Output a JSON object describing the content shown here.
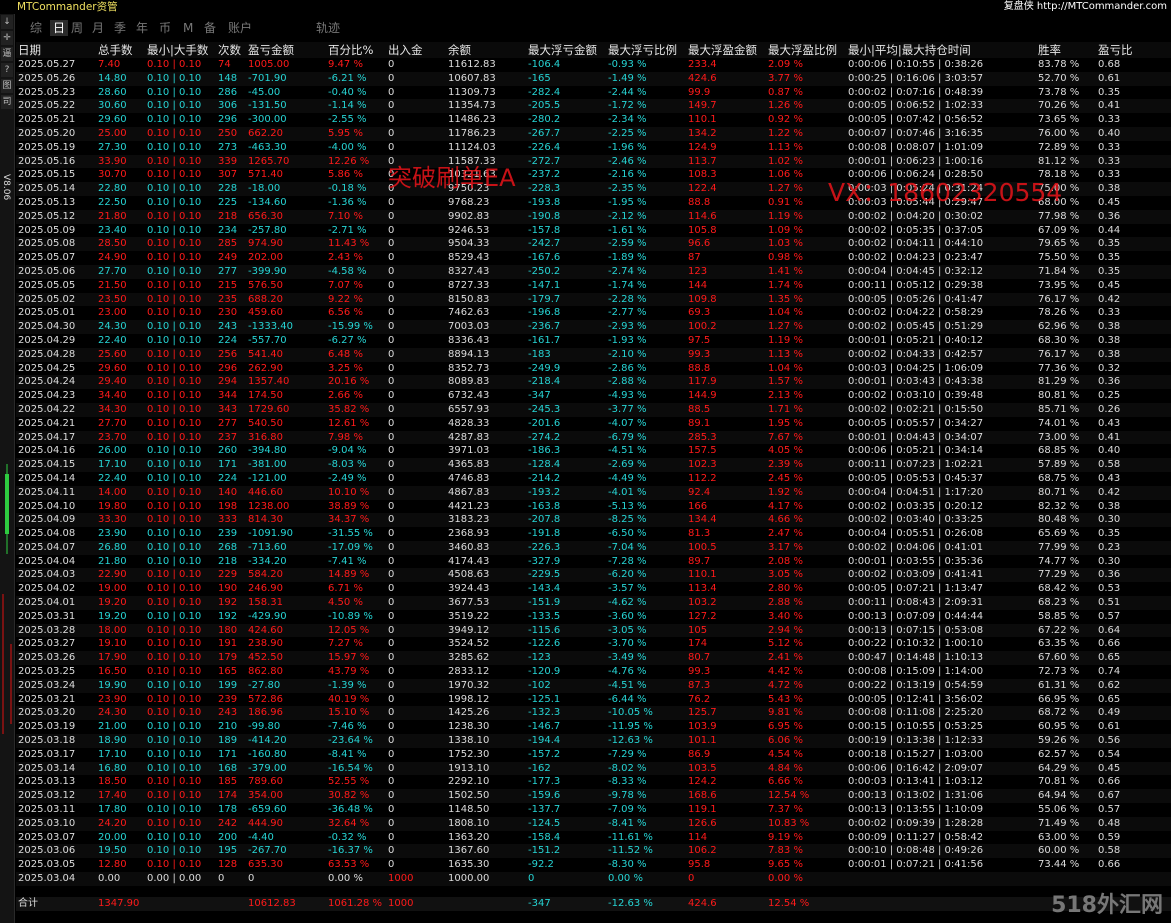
{
  "app": {
    "title": "MTCommander资管",
    "link": "复盘侠 http://MTCommander.com"
  },
  "toolbar": {
    "buttons": [
      "↓",
      "✛",
      "逼",
      "?",
      "图",
      "司"
    ],
    "version": "V8.06"
  },
  "tabs": [
    {
      "label": "综",
      "active": false
    },
    {
      "label": "日",
      "active": true
    },
    {
      "label": "周",
      "active": false
    },
    {
      "label": "月",
      "active": false
    },
    {
      "label": "季",
      "active": false
    },
    {
      "label": "年",
      "active": false
    },
    {
      "label": "币",
      "active": false
    },
    {
      "label": "M",
      "active": false
    },
    {
      "label": "备",
      "active": false
    },
    {
      "label": "账户",
      "active": false
    },
    {
      "label": "轨迹",
      "active": false
    }
  ],
  "columns": [
    "日期",
    "总手数",
    "最小|大手数",
    "次数",
    "盈亏金额",
    "百分比%",
    "出入金",
    "余额",
    "最大浮亏金额",
    "最大浮亏比例",
    "最大浮盈金额",
    "最大浮盈比例",
    "最小|平均|最大持仓时间",
    "胜率",
    "盈亏比"
  ],
  "rows": [
    [
      "2025.05.27",
      "7.40",
      "0.10 | 0.10",
      "74",
      "1005.00",
      "9.47 %",
      "0",
      "11612.83",
      "-106.4",
      "-0.93 %",
      "233.4",
      "2.09 %",
      "0:00:06 | 0:10:55 | 0:38:26",
      "83.78 %",
      "0.68"
    ],
    [
      "2025.05.26",
      "14.80",
      "0.10 | 0.10",
      "148",
      "-701.90",
      "-6.21 %",
      "0",
      "10607.83",
      "-165",
      "-1.49 %",
      "424.6",
      "3.77 %",
      "0:00:25 | 0:16:06 | 3:03:57",
      "52.70 %",
      "0.61"
    ],
    [
      "2025.05.23",
      "28.60",
      "0.10 | 0.10",
      "286",
      "-45.00",
      "-0.40 %",
      "0",
      "11309.73",
      "-282.4",
      "-2.44 %",
      "99.9",
      "0.87 %",
      "0:00:02 | 0:07:16 | 0:48:39",
      "73.78 %",
      "0.35"
    ],
    [
      "2025.05.22",
      "30.60",
      "0.10 | 0.10",
      "306",
      "-131.50",
      "-1.14 %",
      "0",
      "11354.73",
      "-205.5",
      "-1.72 %",
      "149.7",
      "1.26 %",
      "0:00:05 | 0:06:52 | 1:02:33",
      "70.26 %",
      "0.41"
    ],
    [
      "2025.05.21",
      "29.60",
      "0.10 | 0.10",
      "296",
      "-300.00",
      "-2.55 %",
      "0",
      "11486.23",
      "-280.2",
      "-2.34 %",
      "110.1",
      "0.92 %",
      "0:00:05 | 0:07:42 | 0:56:52",
      "73.65 %",
      "0.33"
    ],
    [
      "2025.05.20",
      "25.00",
      "0.10 | 0.10",
      "250",
      "662.20",
      "5.95 %",
      "0",
      "11786.23",
      "-267.7",
      "-2.25 %",
      "134.2",
      "1.22 %",
      "0:00:07 | 0:07:46 | 3:16:35",
      "76.00 %",
      "0.40"
    ],
    [
      "2025.05.19",
      "27.30",
      "0.10 | 0.10",
      "273",
      "-463.30",
      "-4.00 %",
      "0",
      "11124.03",
      "-226.4",
      "-1.96 %",
      "124.9",
      "1.13 %",
      "0:00:08 | 0:08:07 | 1:01:09",
      "72.89 %",
      "0.33"
    ],
    [
      "2025.05.16",
      "33.90",
      "0.10 | 0.10",
      "339",
      "1265.70",
      "12.26 %",
      "0",
      "11587.33",
      "-272.7",
      "-2.46 %",
      "113.7",
      "1.02 %",
      "0:00:01 | 0:06:23 | 1:00:16",
      "81.12 %",
      "0.33"
    ],
    [
      "2025.05.15",
      "30.70",
      "0.10 | 0.10",
      "307",
      "571.40",
      "5.86 %",
      "0",
      "10321.63",
      "-237.2",
      "-2.16 %",
      "108.3",
      "1.06 %",
      "0:00:06 | 0:06:24 | 0:28:50",
      "78.18 %",
      "0.33"
    ],
    [
      "2025.05.14",
      "22.80",
      "0.10 | 0.10",
      "228",
      "-18.00",
      "-0.18 %",
      "0",
      "9750.23",
      "-228.3",
      "-2.35 %",
      "122.4",
      "1.27 %",
      "0:00:03 | 0:05:24 | 0:31:24",
      "75.00 %",
      "0.38"
    ],
    [
      "2025.05.13",
      "22.50",
      "0.10 | 0.10",
      "225",
      "-134.60",
      "-1.36 %",
      "0",
      "9768.23",
      "-193.8",
      "-1.95 %",
      "88.8",
      "0.91 %",
      "0:00:03 | 0:05:44 | 0:29:47",
      "68.00 %",
      "0.45"
    ],
    [
      "2025.05.12",
      "21.80",
      "0.10 | 0.10",
      "218",
      "656.30",
      "7.10 %",
      "0",
      "9902.83",
      "-190.8",
      "-2.12 %",
      "114.6",
      "1.19 %",
      "0:00:02 | 0:04:20 | 0:30:02",
      "77.98 %",
      "0.36"
    ],
    [
      "2025.05.09",
      "23.40",
      "0.10 | 0.10",
      "234",
      "-257.80",
      "-2.71 %",
      "0",
      "9246.53",
      "-157.8",
      "-1.61 %",
      "105.8",
      "1.09 %",
      "0:00:02 | 0:05:35 | 0:37:05",
      "67.09 %",
      "0.44"
    ],
    [
      "2025.05.08",
      "28.50",
      "0.10 | 0.10",
      "285",
      "974.90",
      "11.43 %",
      "0",
      "9504.33",
      "-242.7",
      "-2.59 %",
      "96.6",
      "1.03 %",
      "0:00:02 | 0:04:11 | 0:44:10",
      "79.65 %",
      "0.35"
    ],
    [
      "2025.05.07",
      "24.90",
      "0.10 | 0.10",
      "249",
      "202.00",
      "2.43 %",
      "0",
      "8529.43",
      "-167.6",
      "-1.89 %",
      "87",
      "0.98 %",
      "0:00:02 | 0:04:23 | 0:23:47",
      "75.50 %",
      "0.35"
    ],
    [
      "2025.05.06",
      "27.70",
      "0.10 | 0.10",
      "277",
      "-399.90",
      "-4.58 %",
      "0",
      "8327.43",
      "-250.2",
      "-2.74 %",
      "123",
      "1.41 %",
      "0:00:04 | 0:04:45 | 0:32:12",
      "71.84 %",
      "0.35"
    ],
    [
      "2025.05.05",
      "21.50",
      "0.10 | 0.10",
      "215",
      "576.50",
      "7.07 %",
      "0",
      "8727.33",
      "-147.1",
      "-1.74 %",
      "144",
      "1.74 %",
      "0:00:11 | 0:05:12 | 0:29:38",
      "73.95 %",
      "0.45"
    ],
    [
      "2025.05.02",
      "23.50",
      "0.10 | 0.10",
      "235",
      "688.20",
      "9.22 %",
      "0",
      "8150.83",
      "-179.7",
      "-2.28 %",
      "109.8",
      "1.35 %",
      "0:00:05 | 0:05:26 | 0:41:47",
      "76.17 %",
      "0.42"
    ],
    [
      "2025.05.01",
      "23.00",
      "0.10 | 0.10",
      "230",
      "459.60",
      "6.56 %",
      "0",
      "7462.63",
      "-196.8",
      "-2.77 %",
      "69.3",
      "1.04 %",
      "0:00:02 | 0:04:22 | 0:58:29",
      "78.26 %",
      "0.33"
    ],
    [
      "2025.04.30",
      "24.30",
      "0.10 | 0.10",
      "243",
      "-1333.40",
      "-15.99 %",
      "0",
      "7003.03",
      "-236.7",
      "-2.93 %",
      "100.2",
      "1.27 %",
      "0:00:02 | 0:05:45 | 0:51:29",
      "62.96 %",
      "0.38"
    ],
    [
      "2025.04.29",
      "22.40",
      "0.10 | 0.10",
      "224",
      "-557.70",
      "-6.27 %",
      "0",
      "8336.43",
      "-161.7",
      "-1.93 %",
      "97.5",
      "1.19 %",
      "0:00:01 | 0:05:21 | 0:40:12",
      "68.30 %",
      "0.38"
    ],
    [
      "2025.04.28",
      "25.60",
      "0.10 | 0.10",
      "256",
      "541.40",
      "6.48 %",
      "0",
      "8894.13",
      "-183",
      "-2.10 %",
      "99.3",
      "1.13 %",
      "0:00:02 | 0:04:33 | 0:42:57",
      "76.17 %",
      "0.38"
    ],
    [
      "2025.04.25",
      "29.60",
      "0.10 | 0.10",
      "296",
      "262.90",
      "3.25 %",
      "0",
      "8352.73",
      "-249.9",
      "-2.86 %",
      "88.8",
      "1.04 %",
      "0:00:03 | 0:04:25 | 1:06:09",
      "77.36 %",
      "0.32"
    ],
    [
      "2025.04.24",
      "29.40",
      "0.10 | 0.10",
      "294",
      "1357.40",
      "20.16 %",
      "0",
      "8089.83",
      "-218.4",
      "-2.88 %",
      "117.9",
      "1.57 %",
      "0:00:01 | 0:03:43 | 0:43:38",
      "81.29 %",
      "0.36"
    ],
    [
      "2025.04.23",
      "34.40",
      "0.10 | 0.10",
      "344",
      "174.50",
      "2.66 %",
      "0",
      "6732.43",
      "-347",
      "-4.93 %",
      "144.9",
      "2.13 %",
      "0:00:02 | 0:03:10 | 0:39:48",
      "80.81 %",
      "0.25"
    ],
    [
      "2025.04.22",
      "34.30",
      "0.10 | 0.10",
      "343",
      "1729.60",
      "35.82 %",
      "0",
      "6557.93",
      "-245.3",
      "-3.77 %",
      "88.5",
      "1.71 %",
      "0:00:02 | 0:02:21 | 0:15:50",
      "85.71 %",
      "0.26"
    ],
    [
      "2025.04.21",
      "27.70",
      "0.10 | 0.10",
      "277",
      "540.50",
      "12.61 %",
      "0",
      "4828.33",
      "-201.6",
      "-4.07 %",
      "89.1",
      "1.95 %",
      "0:00:05 | 0:05:57 | 0:34:27",
      "74.01 %",
      "0.43"
    ],
    [
      "2025.04.17",
      "23.70",
      "0.10 | 0.10",
      "237",
      "316.80",
      "7.98 %",
      "0",
      "4287.83",
      "-274.2",
      "-6.79 %",
      "285.3",
      "7.67 %",
      "0:00:01 | 0:04:43 | 0:34:07",
      "73.00 %",
      "0.41"
    ],
    [
      "2025.04.16",
      "26.00",
      "0.10 | 0.10",
      "260",
      "-394.80",
      "-9.04 %",
      "0",
      "3971.03",
      "-186.3",
      "-4.51 %",
      "157.5",
      "4.05 %",
      "0:00:06 | 0:05:21 | 0:34:14",
      "68.85 %",
      "0.40"
    ],
    [
      "2025.04.15",
      "17.10",
      "0.10 | 0.10",
      "171",
      "-381.00",
      "-8.03 %",
      "0",
      "4365.83",
      "-128.4",
      "-2.69 %",
      "102.3",
      "2.39 %",
      "0:00:11 | 0:07:23 | 1:02:21",
      "57.89 %",
      "0.58"
    ],
    [
      "2025.04.14",
      "22.40",
      "0.10 | 0.10",
      "224",
      "-121.00",
      "-2.49 %",
      "0",
      "4746.83",
      "-214.2",
      "-4.49 %",
      "112.2",
      "2.45 %",
      "0:00:05 | 0:05:53 | 0:45:37",
      "68.75 %",
      "0.43"
    ],
    [
      "2025.04.11",
      "14.00",
      "0.10 | 0.10",
      "140",
      "446.60",
      "10.10 %",
      "0",
      "4867.83",
      "-193.2",
      "-4.01 %",
      "92.4",
      "1.92 %",
      "0:00:04 | 0:04:51 | 1:17:20",
      "80.71 %",
      "0.42"
    ],
    [
      "2025.04.10",
      "19.80",
      "0.10 | 0.10",
      "198",
      "1238.00",
      "38.89 %",
      "0",
      "4421.23",
      "-163.8",
      "-5.13 %",
      "166",
      "4.17 %",
      "0:00:02 | 0:03:35 | 0:20:12",
      "82.32 %",
      "0.38"
    ],
    [
      "2025.04.09",
      "33.30",
      "0.10 | 0.10",
      "333",
      "814.30",
      "34.37 %",
      "0",
      "3183.23",
      "-207.8",
      "-8.25 %",
      "134.4",
      "4.66 %",
      "0:00:02 | 0:03:40 | 0:33:25",
      "80.48 %",
      "0.30"
    ],
    [
      "2025.04.08",
      "23.90",
      "0.10 | 0.10",
      "239",
      "-1091.90",
      "-31.55 %",
      "0",
      "2368.93",
      "-191.8",
      "-6.50 %",
      "81.3",
      "2.47 %",
      "0:00:04 | 0:05:51 | 0:26:08",
      "65.69 %",
      "0.35"
    ],
    [
      "2025.04.07",
      "26.80",
      "0.10 | 0.10",
      "268",
      "-713.60",
      "-17.09 %",
      "0",
      "3460.83",
      "-226.3",
      "-7.04 %",
      "100.5",
      "3.17 %",
      "0:00:02 | 0:04:06 | 0:41:01",
      "77.99 %",
      "0.23"
    ],
    [
      "2025.04.04",
      "21.80",
      "0.10 | 0.10",
      "218",
      "-334.20",
      "-7.41 %",
      "0",
      "4174.43",
      "-327.9",
      "-7.28 %",
      "89.7",
      "2.08 %",
      "0:00:01 | 0:03:55 | 0:35:36",
      "74.77 %",
      "0.30"
    ],
    [
      "2025.04.03",
      "22.90",
      "0.10 | 0.10",
      "229",
      "584.20",
      "14.89 %",
      "0",
      "4508.63",
      "-229.5",
      "-6.20 %",
      "110.1",
      "3.05 %",
      "0:00:02 | 0:03:09 | 0:41:41",
      "77.29 %",
      "0.36"
    ],
    [
      "2025.04.02",
      "19.00",
      "0.10 | 0.10",
      "190",
      "246.90",
      "6.71 %",
      "0",
      "3924.43",
      "-143.4",
      "-3.57 %",
      "113.4",
      "2.80 %",
      "0:00:05 | 0:07:21 | 1:13:47",
      "68.42 %",
      "0.53"
    ],
    [
      "2025.04.01",
      "19.20",
      "0.10 | 0.10",
      "192",
      "158.31",
      "4.50 %",
      "0",
      "3677.53",
      "-151.9",
      "-4.62 %",
      "103.2",
      "2.88 %",
      "0:00:11 | 0:08:43 | 2:09:31",
      "68.23 %",
      "0.51"
    ],
    [
      "2025.03.31",
      "19.20",
      "0.10 | 0.10",
      "192",
      "-429.90",
      "-10.89 %",
      "0",
      "3519.22",
      "-133.5",
      "-3.60 %",
      "127.2",
      "3.40 %",
      "0:00:13 | 0:07:09 | 0:44:44",
      "58.85 %",
      "0.57"
    ],
    [
      "2025.03.28",
      "18.00",
      "0.10 | 0.10",
      "180",
      "424.60",
      "12.05 %",
      "0",
      "3949.12",
      "-115.6",
      "-3.05 %",
      "105",
      "2.94 %",
      "0:00:13 | 0:07:15 | 0:53:08",
      "67.22 %",
      "0.64"
    ],
    [
      "2025.03.27",
      "19.10",
      "0.10 | 0.10",
      "191",
      "238.90",
      "7.27 %",
      "0",
      "3524.52",
      "-122.6",
      "-3.70 %",
      "174",
      "5.12 %",
      "0:00:22 | 0:10:32 | 1:00:10",
      "63.35 %",
      "0.66"
    ],
    [
      "2025.03.26",
      "17.90",
      "0.10 | 0.10",
      "179",
      "452.50",
      "15.97 %",
      "0",
      "3285.62",
      "-123",
      "-3.49 %",
      "80.7",
      "2.41 %",
      "0:00:47 | 0:14:48 | 1:10:13",
      "67.60 %",
      "0.65"
    ],
    [
      "2025.03.25",
      "16.50",
      "0.10 | 0.10",
      "165",
      "862.80",
      "43.79 %",
      "0",
      "2833.12",
      "-120.9",
      "-4.76 %",
      "99.3",
      "4.42 %",
      "0:00:08 | 0:15:09 | 1:14:00",
      "72.73 %",
      "0.74"
    ],
    [
      "2025.03.24",
      "19.90",
      "0.10 | 0.10",
      "199",
      "-27.80",
      "-1.39 %",
      "0",
      "1970.32",
      "-102",
      "-4.51 %",
      "87.3",
      "4.72 %",
      "0:00:22 | 0:13:19 | 0:54:59",
      "61.31 %",
      "0.62"
    ],
    [
      "2025.03.21",
      "23.90",
      "0.10 | 0.10",
      "239",
      "572.86",
      "40.19 %",
      "0",
      "1998.12",
      "-125.1",
      "-6.44 %",
      "76.2",
      "5.43 %",
      "0:00:05 | 0:12:41 | 3:56:02",
      "66.95 %",
      "0.65"
    ],
    [
      "2025.03.20",
      "24.30",
      "0.10 | 0.10",
      "243",
      "186.96",
      "15.10 %",
      "0",
      "1425.26",
      "-132.3",
      "-10.05 %",
      "125.7",
      "9.81 %",
      "0:00:08 | 0:11:08 | 2:25:20",
      "68.72 %",
      "0.49"
    ],
    [
      "2025.03.19",
      "21.00",
      "0.10 | 0.10",
      "210",
      "-99.80",
      "-7.46 %",
      "0",
      "1238.30",
      "-146.7",
      "-11.95 %",
      "103.9",
      "6.95 %",
      "0:00:15 | 0:10:55 | 0:53:25",
      "60.95 %",
      "0.61"
    ],
    [
      "2025.03.18",
      "18.90",
      "0.10 | 0.10",
      "189",
      "-414.20",
      "-23.64 %",
      "0",
      "1338.10",
      "-194.4",
      "-12.63 %",
      "101.1",
      "6.06 %",
      "0:00:19 | 0:13:38 | 1:12:33",
      "59.26 %",
      "0.56"
    ],
    [
      "2025.03.17",
      "17.10",
      "0.10 | 0.10",
      "171",
      "-160.80",
      "-8.41 %",
      "0",
      "1752.30",
      "-157.2",
      "-7.29 %",
      "86.9",
      "4.54 %",
      "0:00:18 | 0:15:27 | 1:03:00",
      "62.57 %",
      "0.54"
    ],
    [
      "2025.03.14",
      "16.80",
      "0.10 | 0.10",
      "168",
      "-379.00",
      "-16.54 %",
      "0",
      "1913.10",
      "-162",
      "-8.02 %",
      "103.5",
      "4.84 %",
      "0:00:06 | 0:16:42 | 2:09:07",
      "64.29 %",
      "0.45"
    ],
    [
      "2025.03.13",
      "18.50",
      "0.10 | 0.10",
      "185",
      "789.60",
      "52.55 %",
      "0",
      "2292.10",
      "-177.3",
      "-8.33 %",
      "124.2",
      "6.66 %",
      "0:00:03 | 0:13:41 | 1:03:12",
      "70.81 %",
      "0.66"
    ],
    [
      "2025.03.12",
      "17.40",
      "0.10 | 0.10",
      "174",
      "354.00",
      "30.82 %",
      "0",
      "1502.50",
      "-159.6",
      "-9.78 %",
      "168.6",
      "12.54 %",
      "0:00:13 | 0:13:02 | 1:31:06",
      "64.94 %",
      "0.67"
    ],
    [
      "2025.03.11",
      "17.80",
      "0.10 | 0.10",
      "178",
      "-659.60",
      "-36.48 %",
      "0",
      "1148.50",
      "-137.7",
      "-7.09 %",
      "119.1",
      "7.37 %",
      "0:00:13 | 0:13:55 | 1:10:09",
      "55.06 %",
      "0.57"
    ],
    [
      "2025.03.10",
      "24.20",
      "0.10 | 0.10",
      "242",
      "444.90",
      "32.64 %",
      "0",
      "1808.10",
      "-124.5",
      "-8.41 %",
      "126.6",
      "10.83 %",
      "0:00:02 | 0:09:39 | 1:28:28",
      "71.49 %",
      "0.48"
    ],
    [
      "2025.03.07",
      "20.00",
      "0.10 | 0.10",
      "200",
      "-4.40",
      "-0.32 %",
      "0",
      "1363.20",
      "-158.4",
      "-11.61 %",
      "114",
      "9.19 %",
      "0:00:09 | 0:11:27 | 0:58:42",
      "63.00 %",
      "0.59"
    ],
    [
      "2025.03.06",
      "19.50",
      "0.10 | 0.10",
      "195",
      "-267.70",
      "-16.37 %",
      "0",
      "1367.60",
      "-151.2",
      "-11.52 %",
      "106.2",
      "7.83 %",
      "0:00:10 | 0:08:48 | 0:49:26",
      "60.00 %",
      "0.58"
    ],
    [
      "2025.03.05",
      "12.80",
      "0.10 | 0.10",
      "128",
      "635.30",
      "63.53 %",
      "0",
      "1635.30",
      "-92.2",
      "-8.30 %",
      "95.8",
      "9.65 %",
      "0:00:01 | 0:07:21 | 0:41:56",
      "73.44 %",
      "0.66"
    ],
    [
      "2025.03.04",
      "0.00",
      "0.00 | 0.00",
      "0",
      "0",
      "0.00 %",
      "1000",
      "1000.00",
      "0",
      "0.00 %",
      "0",
      "0.00 %",
      "",
      "",
      ""
    ]
  ],
  "totals": {
    "label": "合计",
    "lots": "1347.90",
    "pnl": "10612.83",
    "pct": "1061.28 %",
    "deposit": "1000",
    "max_dd": "-347",
    "max_dd_pct": "-12.63 %",
    "max_fp": "424.6",
    "max_fp_pct": "12.54 %"
  },
  "watermarks": {
    "ea": "突破刷单EA",
    "vx": "VX：18602320554",
    "site": "518外汇网"
  },
  "colors": {
    "profit": "#ff1a1a",
    "loss": "#26d4d4",
    "title": "#f0e060",
    "background": "#000000"
  }
}
